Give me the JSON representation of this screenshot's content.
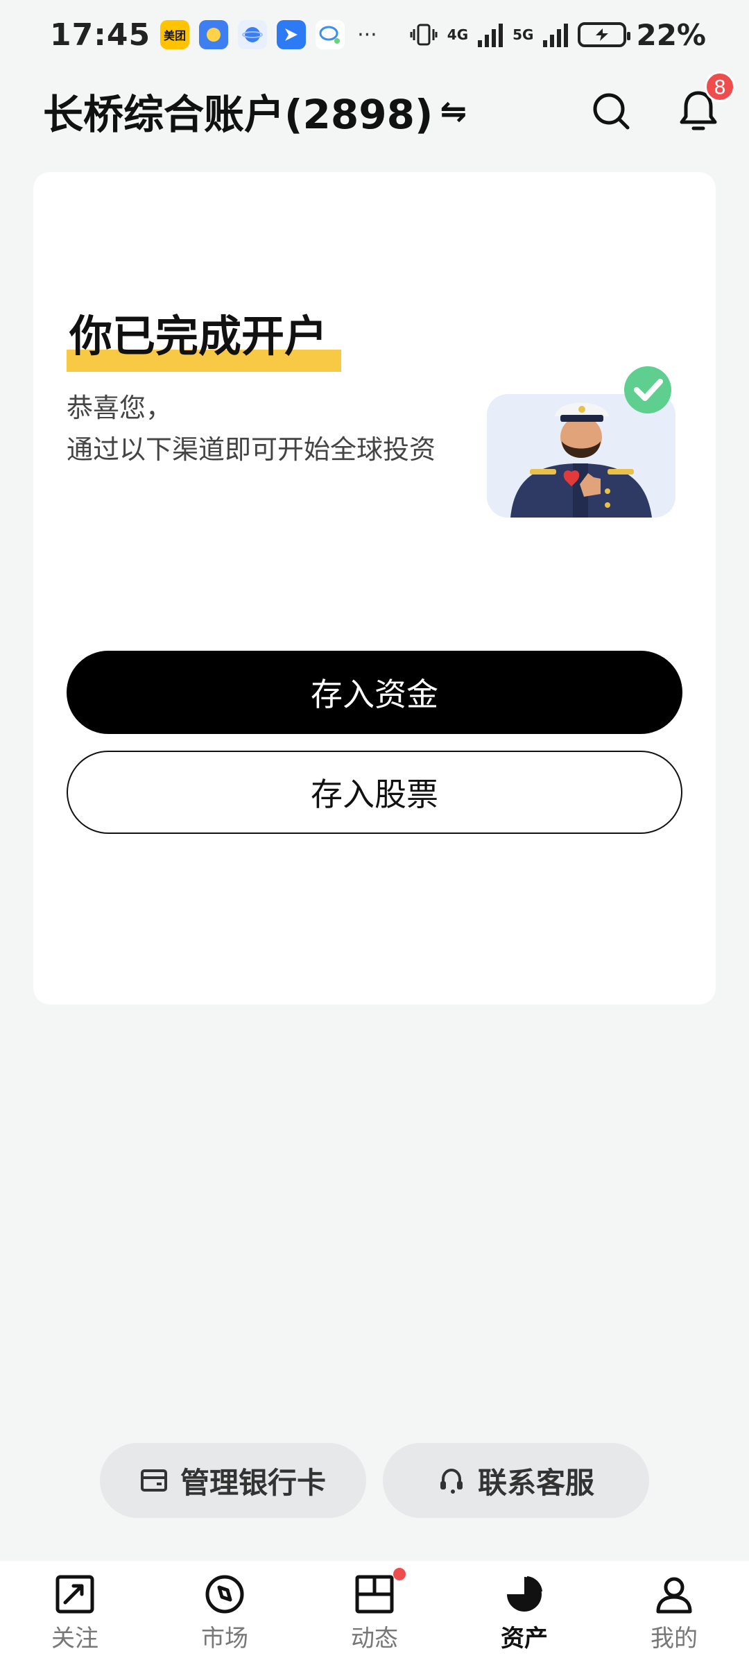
{
  "status_bar": {
    "time": "17:45",
    "app_icons": [
      "meituan-icon",
      "weather-icon",
      "browser-icon",
      "feishu-icon",
      "message-icon"
    ],
    "more": "···",
    "net_4g": "4G",
    "net_5g": "5G",
    "battery": "22%"
  },
  "header": {
    "account_title": "长桥综合账户(2898)",
    "swap_icon": "⇋",
    "notification_count": "8"
  },
  "card": {
    "title": "你已完成开户",
    "subtitle_line1": "恭喜您，",
    "subtitle_line2": "通过以下渠道即可开始全球投资",
    "deposit_funds_label": "存入资金",
    "deposit_stocks_label": "存入股票"
  },
  "pills": {
    "bank_label": "管理银行卡",
    "service_label": "联系客服"
  },
  "tabbar": {
    "items": [
      {
        "label": "关注",
        "icon": "watchlist-icon"
      },
      {
        "label": "市场",
        "icon": "market-icon"
      },
      {
        "label": "动态",
        "icon": "feed-icon"
      },
      {
        "label": "资产",
        "icon": "assets-icon",
        "active": true
      },
      {
        "label": "我的",
        "icon": "profile-icon"
      }
    ]
  },
  "colors": {
    "highlight": "#f7c944",
    "badge": "#ef4d4d",
    "primary_button": "#000000",
    "check_green": "#5fcf8f"
  }
}
